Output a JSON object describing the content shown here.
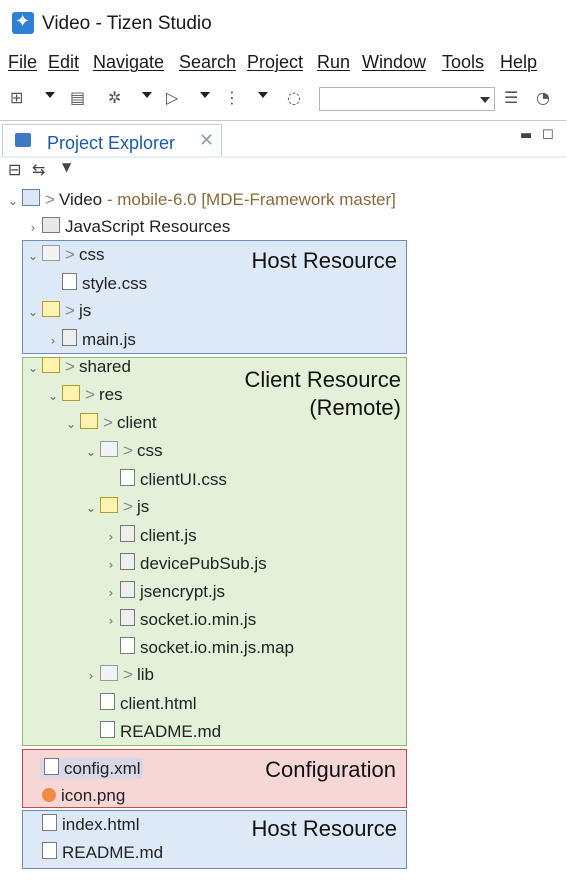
{
  "window": {
    "title": "Video - Tizen Studio"
  },
  "menu": [
    "File",
    "Edit",
    "Navigate",
    "Search",
    "Project",
    "Run",
    "Window",
    "Tools",
    "Help"
  ],
  "toolbar": {
    "icons": [
      "new-wizard-icon",
      "save-all-icon",
      "debug-icon",
      "run-icon",
      "run-config-icon",
      "stop-icon",
      "device-list-icon",
      "monitor-icon"
    ],
    "combo_value": ""
  },
  "view": {
    "tab_label": "Project Explorer",
    "close_glyph": "✕"
  },
  "project": {
    "name": "Video",
    "decoration": " - mobile-6.0 [MDE-Framework master]"
  },
  "tree": {
    "javascript_resources": "JavaScript Resources",
    "css": "css",
    "style_css": "style.css",
    "js": "js",
    "main_js": "main.js",
    "shared": "shared",
    "res": "res",
    "client": "client",
    "client_css": "css",
    "clientui_css": "clientUI.css",
    "client_js": "js",
    "client_js_file": "client.js",
    "devicepubsub_js": "devicePubSub.js",
    "jsencrypt_js": "jsencrypt.js",
    "socketio_min_js": "socket.io.min.js",
    "socketio_min_js_map": "socket.io.min.js.map",
    "lib": "lib",
    "client_html": "client.html",
    "client_readme": "README.md",
    "config_xml": "config.xml",
    "icon_png": "icon.png",
    "index_html": "index.html",
    "root_readme": "README.md"
  },
  "regions": {
    "host_top": "Host Resource",
    "client": "Client Resource",
    "client_sub": "(Remote)",
    "config": "Configuration",
    "host_bottom": "Host Resource"
  },
  "colors": {
    "host_bg": "#dde9f6",
    "host_border": "#6c8fbd",
    "client_bg": "#e3f1d8",
    "client_border": "#8cbb6e",
    "config_bg": "#f7d7d6",
    "config_border": "#c24a4a",
    "tab_text": "#1e5aa8"
  }
}
